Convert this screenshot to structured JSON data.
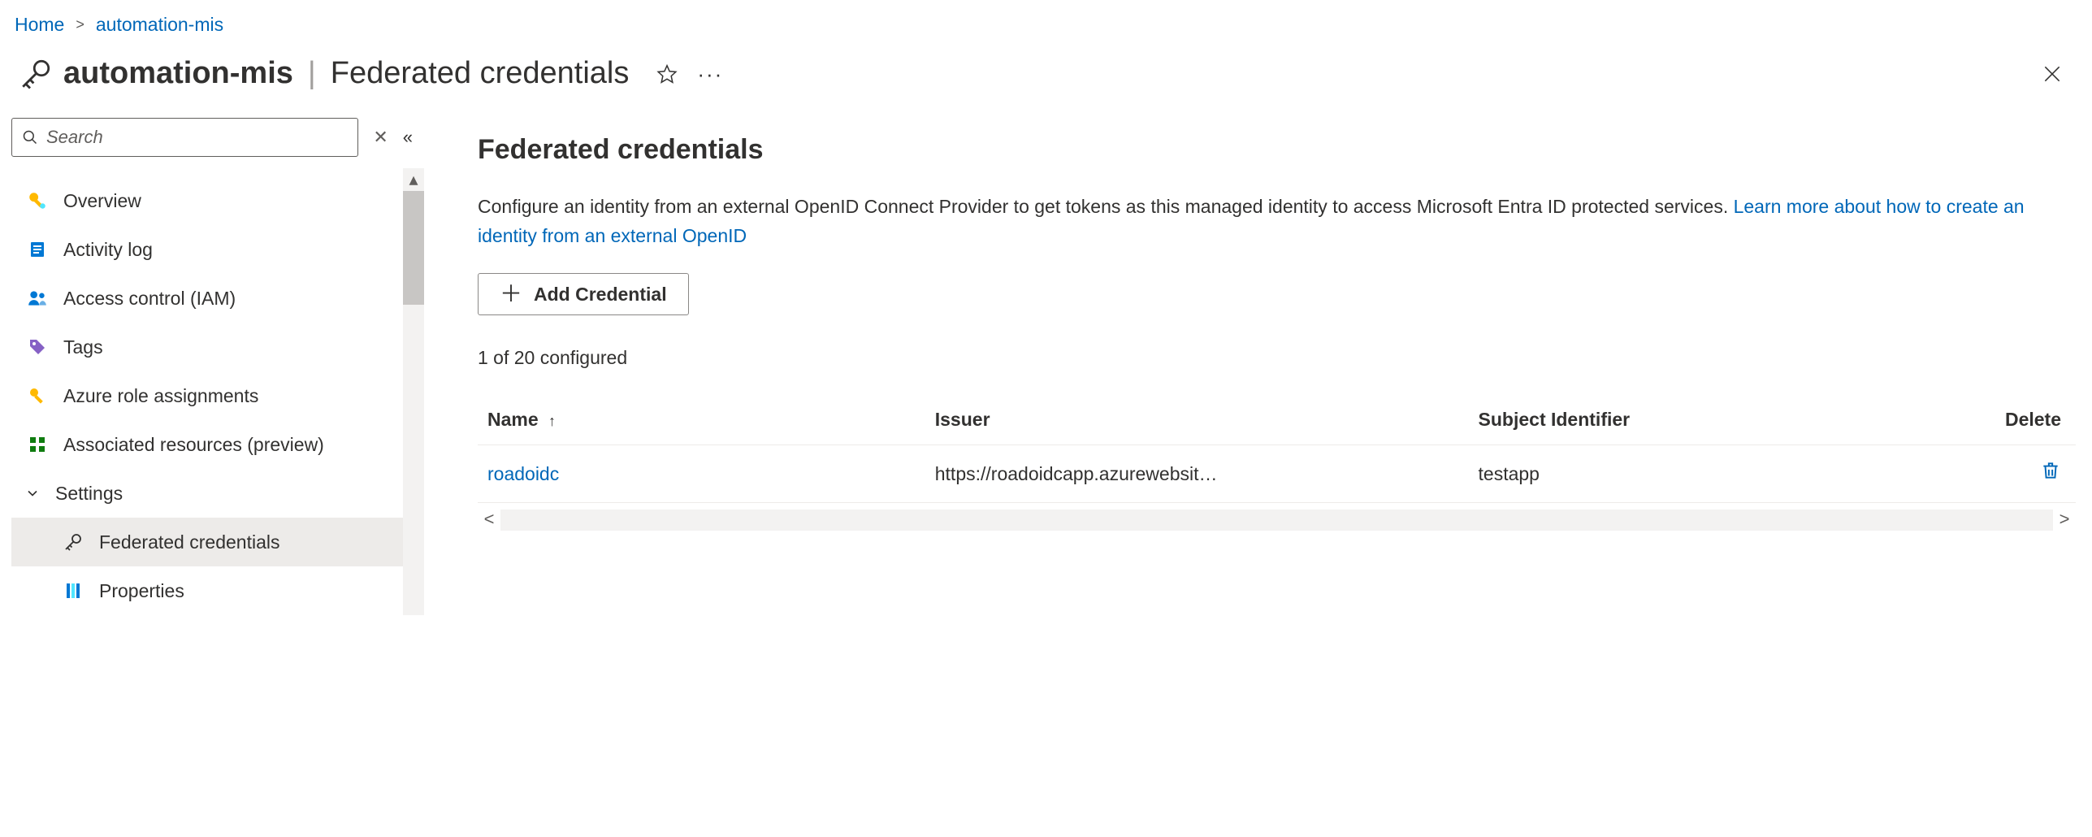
{
  "breadcrumb": {
    "home": "Home",
    "resource": "automation-mis"
  },
  "title": {
    "resource": "automation-mis",
    "blade": "Federated credentials"
  },
  "search": {
    "placeholder": "Search"
  },
  "nav": {
    "overview": "Overview",
    "activity_log": "Activity log",
    "access_control": "Access control (IAM)",
    "tags": "Tags",
    "azure_role": "Azure role assignments",
    "assoc_resources": "Associated resources (preview)",
    "settings_header": "Settings",
    "federated": "Federated credentials",
    "properties": "Properties"
  },
  "content": {
    "heading": "Federated credentials",
    "desc_pre": "Configure an identity from an external OpenID Connect Provider to get tokens as this managed identity to access Microsoft Entra ID protected services. ",
    "learn_more": "Learn more about how to create an identity from an external OpenID",
    "add_button": "Add Credential",
    "status": "1 of 20 configured",
    "columns": {
      "name": "Name",
      "issuer": "Issuer",
      "subject": "Subject Identifier",
      "delete": "Delete"
    },
    "rows": [
      {
        "name": "roadoidc",
        "issuer": "https://roadoidcapp.azurewebsit…",
        "subject": "testapp"
      }
    ]
  }
}
